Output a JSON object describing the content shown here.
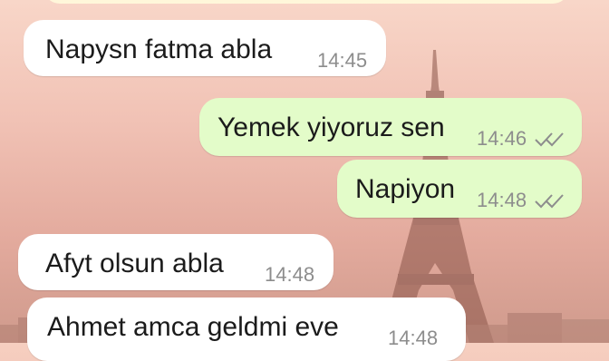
{
  "messages": [
    {
      "direction": "incoming",
      "text": "Napysn fatma abla",
      "time": "14:45"
    },
    {
      "direction": "outgoing",
      "text": "Yemek yiyoruz sen",
      "time": "14:46",
      "status": "read"
    },
    {
      "direction": "outgoing",
      "text": "Napiyon",
      "time": "14:48",
      "status": "read"
    },
    {
      "direction": "incoming",
      "text": "Afyt olsun abla",
      "time": "14:48"
    },
    {
      "direction": "incoming",
      "text": "Ahmet amca geldmi eve",
      "time": "14:48"
    }
  ],
  "colors": {
    "incoming_bubble": "#ffffff",
    "outgoing_bubble": "#e3fcc9",
    "timestamp": "#8d8d8d",
    "read_ticks": "#8d8d8d"
  },
  "icons": {
    "read_receipt": "double-check-icon"
  }
}
